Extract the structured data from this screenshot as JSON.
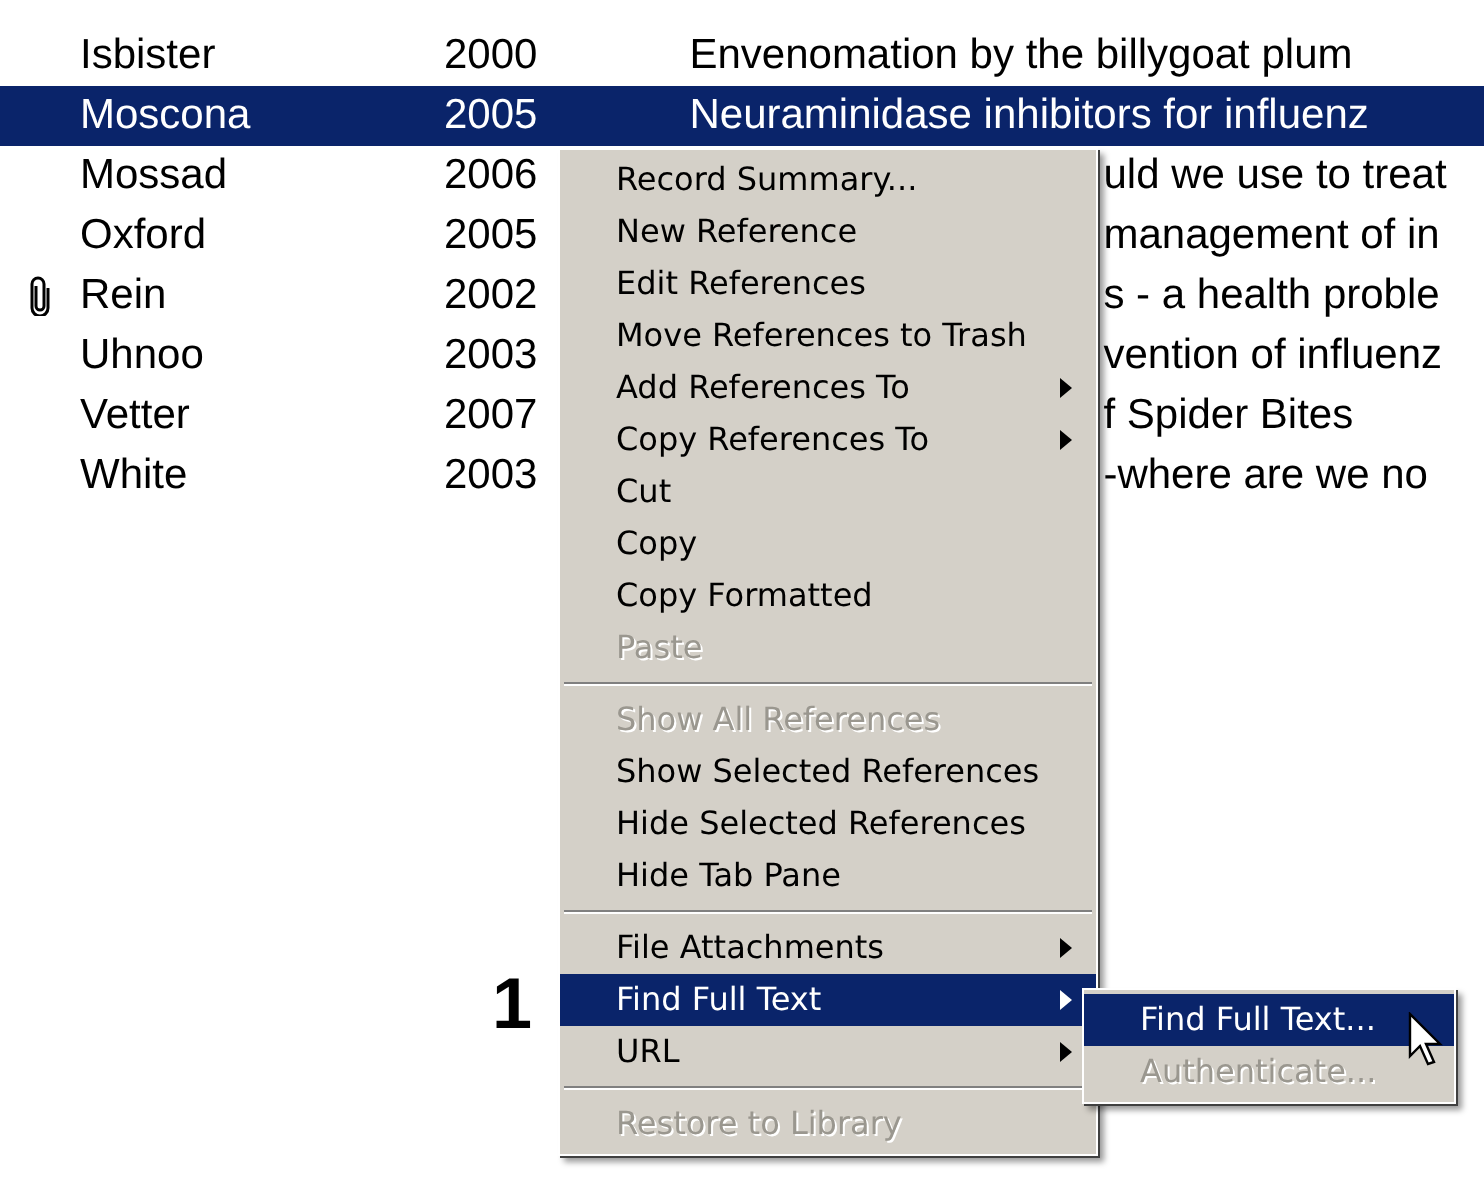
{
  "rows": [
    {
      "author": "Isbister",
      "year": "2000",
      "title": "Envenomation by the billygoat plum",
      "covered": false,
      "selected": false,
      "attached": false
    },
    {
      "author": "Moscona",
      "year": "2005",
      "title": "Neuraminidase inhibitors for influenz",
      "covered": false,
      "selected": true,
      "attached": false
    },
    {
      "author": "Mossad",
      "year": "2006",
      "title": "uld we use to treat",
      "covered": true,
      "selected": false,
      "attached": false
    },
    {
      "author": "Oxford",
      "year": "2005",
      "title": "management of in",
      "covered": true,
      "selected": false,
      "attached": false
    },
    {
      "author": "Rein",
      "year": "2002",
      "title": "s - a health proble",
      "covered": true,
      "selected": false,
      "attached": true
    },
    {
      "author": "Uhnoo",
      "year": "2003",
      "title": "vention of influenz",
      "covered": true,
      "selected": false,
      "attached": false
    },
    {
      "author": "Vetter",
      "year": "2007",
      "title": "f Spider Bites",
      "covered": true,
      "selected": false,
      "attached": false
    },
    {
      "author": "White",
      "year": "2003",
      "title": "-where are we no",
      "covered": true,
      "selected": false,
      "attached": false
    }
  ],
  "context_menu": [
    {
      "kind": "item",
      "label": "Record Summary...",
      "disabled": false,
      "submenu": false,
      "selected": false
    },
    {
      "kind": "item",
      "label": "New Reference",
      "disabled": false,
      "submenu": false,
      "selected": false
    },
    {
      "kind": "item",
      "label": "Edit References",
      "disabled": false,
      "submenu": false,
      "selected": false
    },
    {
      "kind": "item",
      "label": "Move References to Trash",
      "disabled": false,
      "submenu": false,
      "selected": false
    },
    {
      "kind": "item",
      "label": "Add References To",
      "disabled": false,
      "submenu": true,
      "selected": false
    },
    {
      "kind": "item",
      "label": "Copy References To",
      "disabled": false,
      "submenu": true,
      "selected": false
    },
    {
      "kind": "item",
      "label": "Cut",
      "disabled": false,
      "submenu": false,
      "selected": false
    },
    {
      "kind": "item",
      "label": "Copy",
      "disabled": false,
      "submenu": false,
      "selected": false
    },
    {
      "kind": "item",
      "label": "Copy Formatted",
      "disabled": false,
      "submenu": false,
      "selected": false
    },
    {
      "kind": "item",
      "label": "Paste",
      "disabled": true,
      "submenu": false,
      "selected": false
    },
    {
      "kind": "separator"
    },
    {
      "kind": "item",
      "label": "Show All References",
      "disabled": true,
      "submenu": false,
      "selected": false
    },
    {
      "kind": "item",
      "label": "Show Selected References",
      "disabled": false,
      "submenu": false,
      "selected": false
    },
    {
      "kind": "item",
      "label": "Hide Selected References",
      "disabled": false,
      "submenu": false,
      "selected": false
    },
    {
      "kind": "item",
      "label": "Hide Tab Pane",
      "disabled": false,
      "submenu": false,
      "selected": false
    },
    {
      "kind": "separator"
    },
    {
      "kind": "item",
      "label": "File Attachments",
      "disabled": false,
      "submenu": true,
      "selected": false
    },
    {
      "kind": "item",
      "label": "Find Full Text",
      "disabled": false,
      "submenu": true,
      "selected": true
    },
    {
      "kind": "item",
      "label": "URL",
      "disabled": false,
      "submenu": true,
      "selected": false
    },
    {
      "kind": "separator"
    },
    {
      "kind": "item",
      "label": "Restore to Library",
      "disabled": true,
      "submenu": false,
      "selected": false
    }
  ],
  "submenu": [
    {
      "label": "Find Full Text...",
      "disabled": false,
      "selected": true
    },
    {
      "label": "Authenticate...",
      "disabled": true,
      "selected": false
    }
  ],
  "callout": "1"
}
